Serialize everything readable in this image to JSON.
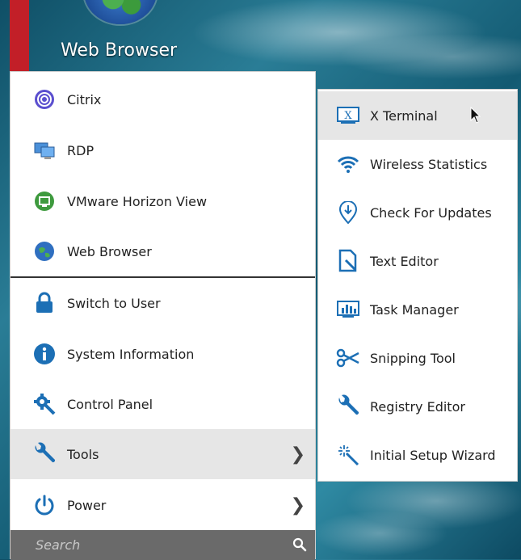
{
  "desktop": {
    "icon_label": "Web Browser"
  },
  "menu": {
    "items": [
      {
        "label": "Citrix",
        "icon": "citrix-icon"
      },
      {
        "label": "RDP",
        "icon": "rdp-icon"
      },
      {
        "label": "VMware Horizon View",
        "icon": "vmware-icon"
      },
      {
        "label": "Web Browser",
        "icon": "globe-icon"
      },
      {
        "label": "Switch to User",
        "icon": "lock-icon"
      },
      {
        "label": "System Information",
        "icon": "info-icon"
      },
      {
        "label": "Control Panel",
        "icon": "gear-icon"
      },
      {
        "label": "Tools",
        "icon": "wrench-icon",
        "submenu": true,
        "active": true
      },
      {
        "label": "Power",
        "icon": "power-icon",
        "submenu": true
      }
    ],
    "search": {
      "placeholder": "Search",
      "value": ""
    }
  },
  "submenu": {
    "items": [
      {
        "label": "X Terminal",
        "icon": "x-terminal-icon",
        "active": true
      },
      {
        "label": "Wireless Statistics",
        "icon": "wifi-icon"
      },
      {
        "label": "Check For Updates",
        "icon": "update-icon"
      },
      {
        "label": "Text Editor",
        "icon": "text-editor-icon"
      },
      {
        "label": "Task Manager",
        "icon": "task-manager-icon"
      },
      {
        "label": "Snipping Tool",
        "icon": "scissors-icon"
      },
      {
        "label": "Registry Editor",
        "icon": "wrench-icon"
      },
      {
        "label": "Initial Setup Wizard",
        "icon": "wizard-icon"
      }
    ]
  },
  "colors": {
    "accent_blue": "#1c6fb5",
    "active_bg": "#e6e6e6",
    "search_bg": "#6a6a6a",
    "red_bar": "#c21f28"
  }
}
